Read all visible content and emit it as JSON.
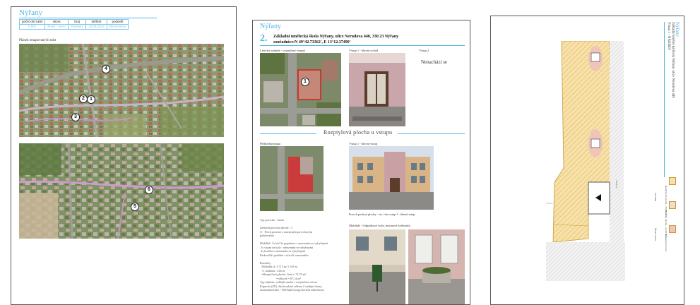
{
  "page1": {
    "title": "Nýřany",
    "table_headers": [
      "počet obyvatel",
      "okres",
      "kraj",
      "měření",
      "podnebí"
    ],
    "table_values": [
      "6 865",
      "Plzeň - sever",
      "Plzeňský",
      "29.08.2018",
      "Bezoblačno"
    ],
    "map_caption": "Plánek emapovaných míst",
    "pins": [
      "4",
      "2",
      "1",
      "3",
      "6",
      "5"
    ]
  },
  "page2": {
    "title": "Nýřany",
    "number": "2.",
    "heading": "Základní umělecká škola Nýřany, ulice Nerudova 440, 330 23 Nýřany",
    "coordinates": "souřadnice:N 49°42.73362', E 13°12.37490'",
    "caption_aerial": "Letecký snímek - vyznačení vstupů",
    "caption_entrance1": "Vstup 1 - hlavní vchod",
    "caption_entrance2": "Vstup 2",
    "missing_note": "Nenachází se",
    "section_title": "Rozptylová plocha u vstupu",
    "caption_map": "Přehledná mapa",
    "caption_entrance_view": "Vstup 1 - hlavní vstup",
    "caption_surface": "Povrch pochozí plochy - viz. foto vstup 1 - hlavní vstup",
    "caption_furniture": "Mobiliář - Odpadkové koše, betonové květináče",
    "body_text": "Typ povrchu - beton\n\nZařízení povrchu dle mř.: 1\nX - Nová pozvání s omezeným povrchovým\npolkřovitím\n\nMobiliář: 1x koš 3x popelnice s omezením se vyhybnými\n 3x stojan na kola - omezením se vyhybnými\n 3x lavička s omezením se vyhybnými\nParkoviště: podélné v ulici K.oraxinného\n\nRozměry\n  Základní: d: 3,713 m; š: 9,8 m\n  +1 hodnota: 1,46 m\n  =Rozptylová plocha: čistá = 72,76 m²\n                      =celková = 87,14 m²\nTyp objektu: vedlejší stavba s ostrým/bez ostrou\nKapacita (ZÚ): škola nabízí celkem 2 studijní obory,\nmaximální (dle) ~ 900 žáků (rozptylová/ní užitečnost)"
  },
  "page3": {
    "title": "Nýřany",
    "number": "2.",
    "heading": "Základní umělecká škola Nýřany, ulice Nerudova 440",
    "subheading": "Vstup 1 - NÁKRES",
    "legend": [
      {
        "label": "Rozptylová plocha - 72,76 m²"
      },
      {
        "label": "Chodník plocha - 14,38 m²"
      },
      {
        "label": "Zamezený provoz"
      }
    ],
    "notes": [
      "Vstup 1",
      "Chodník",
      "Školní vjezd"
    ]
  }
}
